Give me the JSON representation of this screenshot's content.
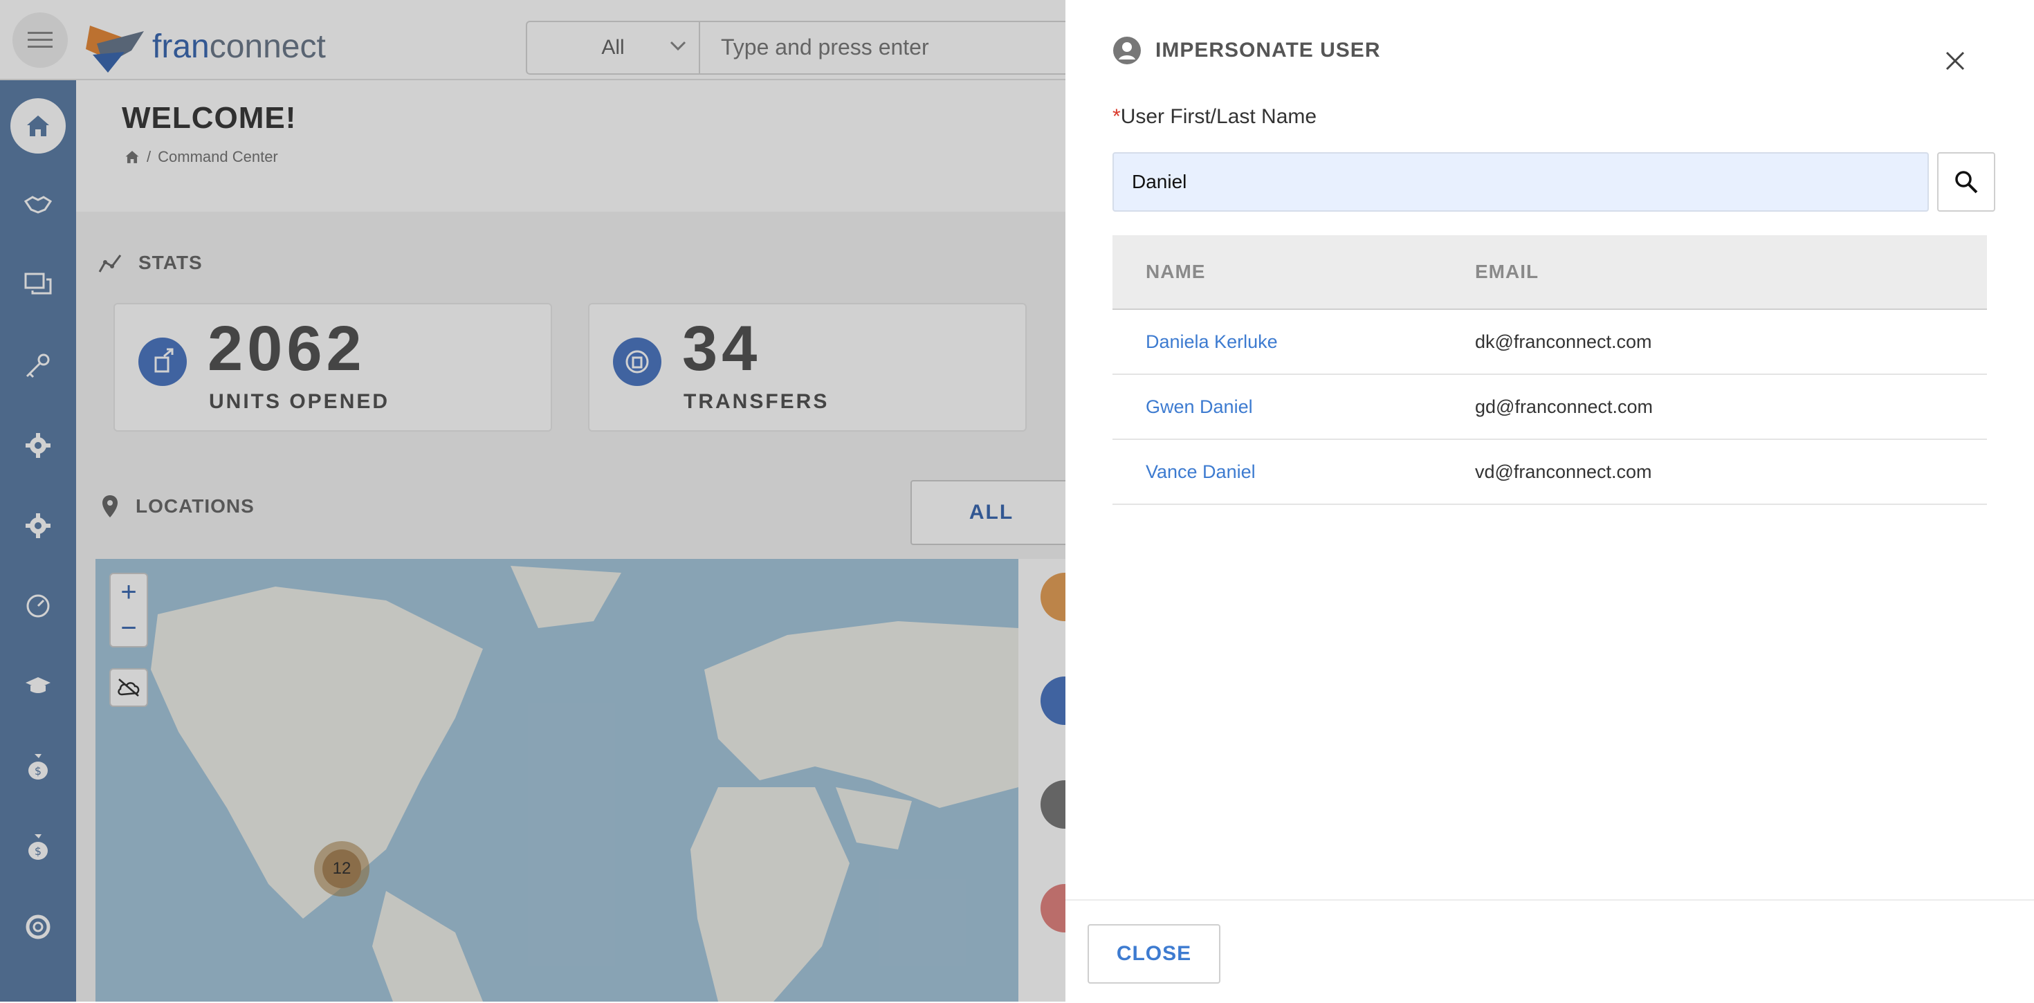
{
  "header": {
    "logo_text_fran": "fran",
    "logo_text_connect": "connect",
    "search_scope": "All",
    "search_placeholder": "Type and press enter"
  },
  "page": {
    "title": "WELCOME!",
    "breadcrumb_sep": "/",
    "breadcrumb": "Command Center"
  },
  "stats": {
    "title": "STATS",
    "cards": [
      {
        "value": "2062",
        "label": "UNITS OPENED"
      },
      {
        "value": "34",
        "label": "TRANSFERS"
      }
    ]
  },
  "locations": {
    "title": "LOCATIONS",
    "filter_label": "ALL",
    "zoom_in": "+",
    "zoom_out": "−",
    "cluster_count": "12"
  },
  "sidebar": {
    "icons": [
      "home-icon",
      "handshake-icon",
      "chat-icon",
      "key-icon",
      "gear-icon",
      "gear-icon",
      "gauge-icon",
      "graduation-cap-icon",
      "money-bag-icon",
      "money-bag-icon",
      "lifebuoy-icon"
    ]
  },
  "drawer": {
    "title": "IMPERSONATE USER",
    "field_required_mark": "*",
    "field_label": "User First/Last Name",
    "field_value": "Daniel",
    "columns": [
      "NAME",
      "EMAIL"
    ],
    "rows": [
      {
        "name": "Daniela Kerluke",
        "email": "dk@franconnect.com"
      },
      {
        "name": "Gwen Daniel",
        "email": "gd@franconnect.com"
      },
      {
        "name": "Vance Daniel",
        "email": "vd@franconnect.com"
      }
    ],
    "close_label": "CLOSE"
  },
  "colors": {
    "accent": "#3d7bd0",
    "sidebar": "#5f7fa8",
    "input_bg": "#e8f0fe",
    "required": "#d9392b"
  }
}
